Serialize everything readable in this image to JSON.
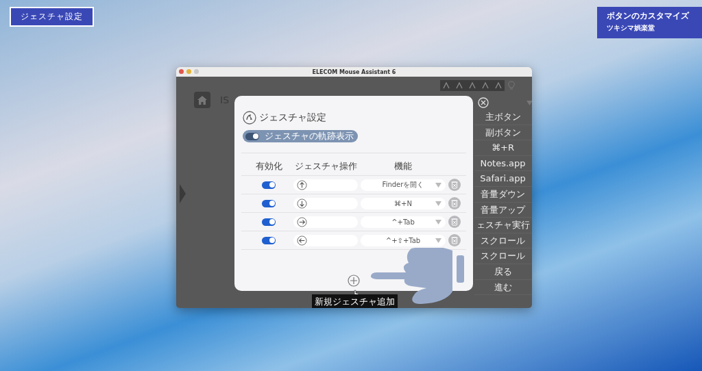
{
  "overlay": {
    "left_label": "ジェスチャ設定",
    "right_title": "ボタンのカスタマイズ",
    "right_subtitle": "ツキシマ娯楽堂"
  },
  "window": {
    "title": "ELECOM Mouse Assistant 6",
    "header_text": "IS",
    "button_list": [
      "主ボタン",
      "副ボタン",
      "⌘+R",
      "Notes.app",
      "Safari.app",
      "音量ダウン",
      "音量アップ",
      "ェスチャ実行",
      "スクロール",
      "スクロール",
      "戻る",
      "進む"
    ]
  },
  "dialog": {
    "title": "ジェスチャ設定",
    "trail_toggle": {
      "label": "ジェスチャの軌跡表示",
      "on": true
    },
    "columns": [
      "有効化",
      "ジェスチャ操作",
      "機能"
    ],
    "rows": [
      {
        "enabled": true,
        "kind": "up",
        "function": "Finderを開く"
      },
      {
        "enabled": true,
        "kind": "down",
        "function": "⌘+N"
      },
      {
        "enabled": true,
        "kind": "right",
        "function": "^+Tab"
      },
      {
        "enabled": true,
        "kind": "left",
        "function": "^+⇧+Tab"
      }
    ],
    "add_tooltip": "新規ジェスチャ追加"
  }
}
